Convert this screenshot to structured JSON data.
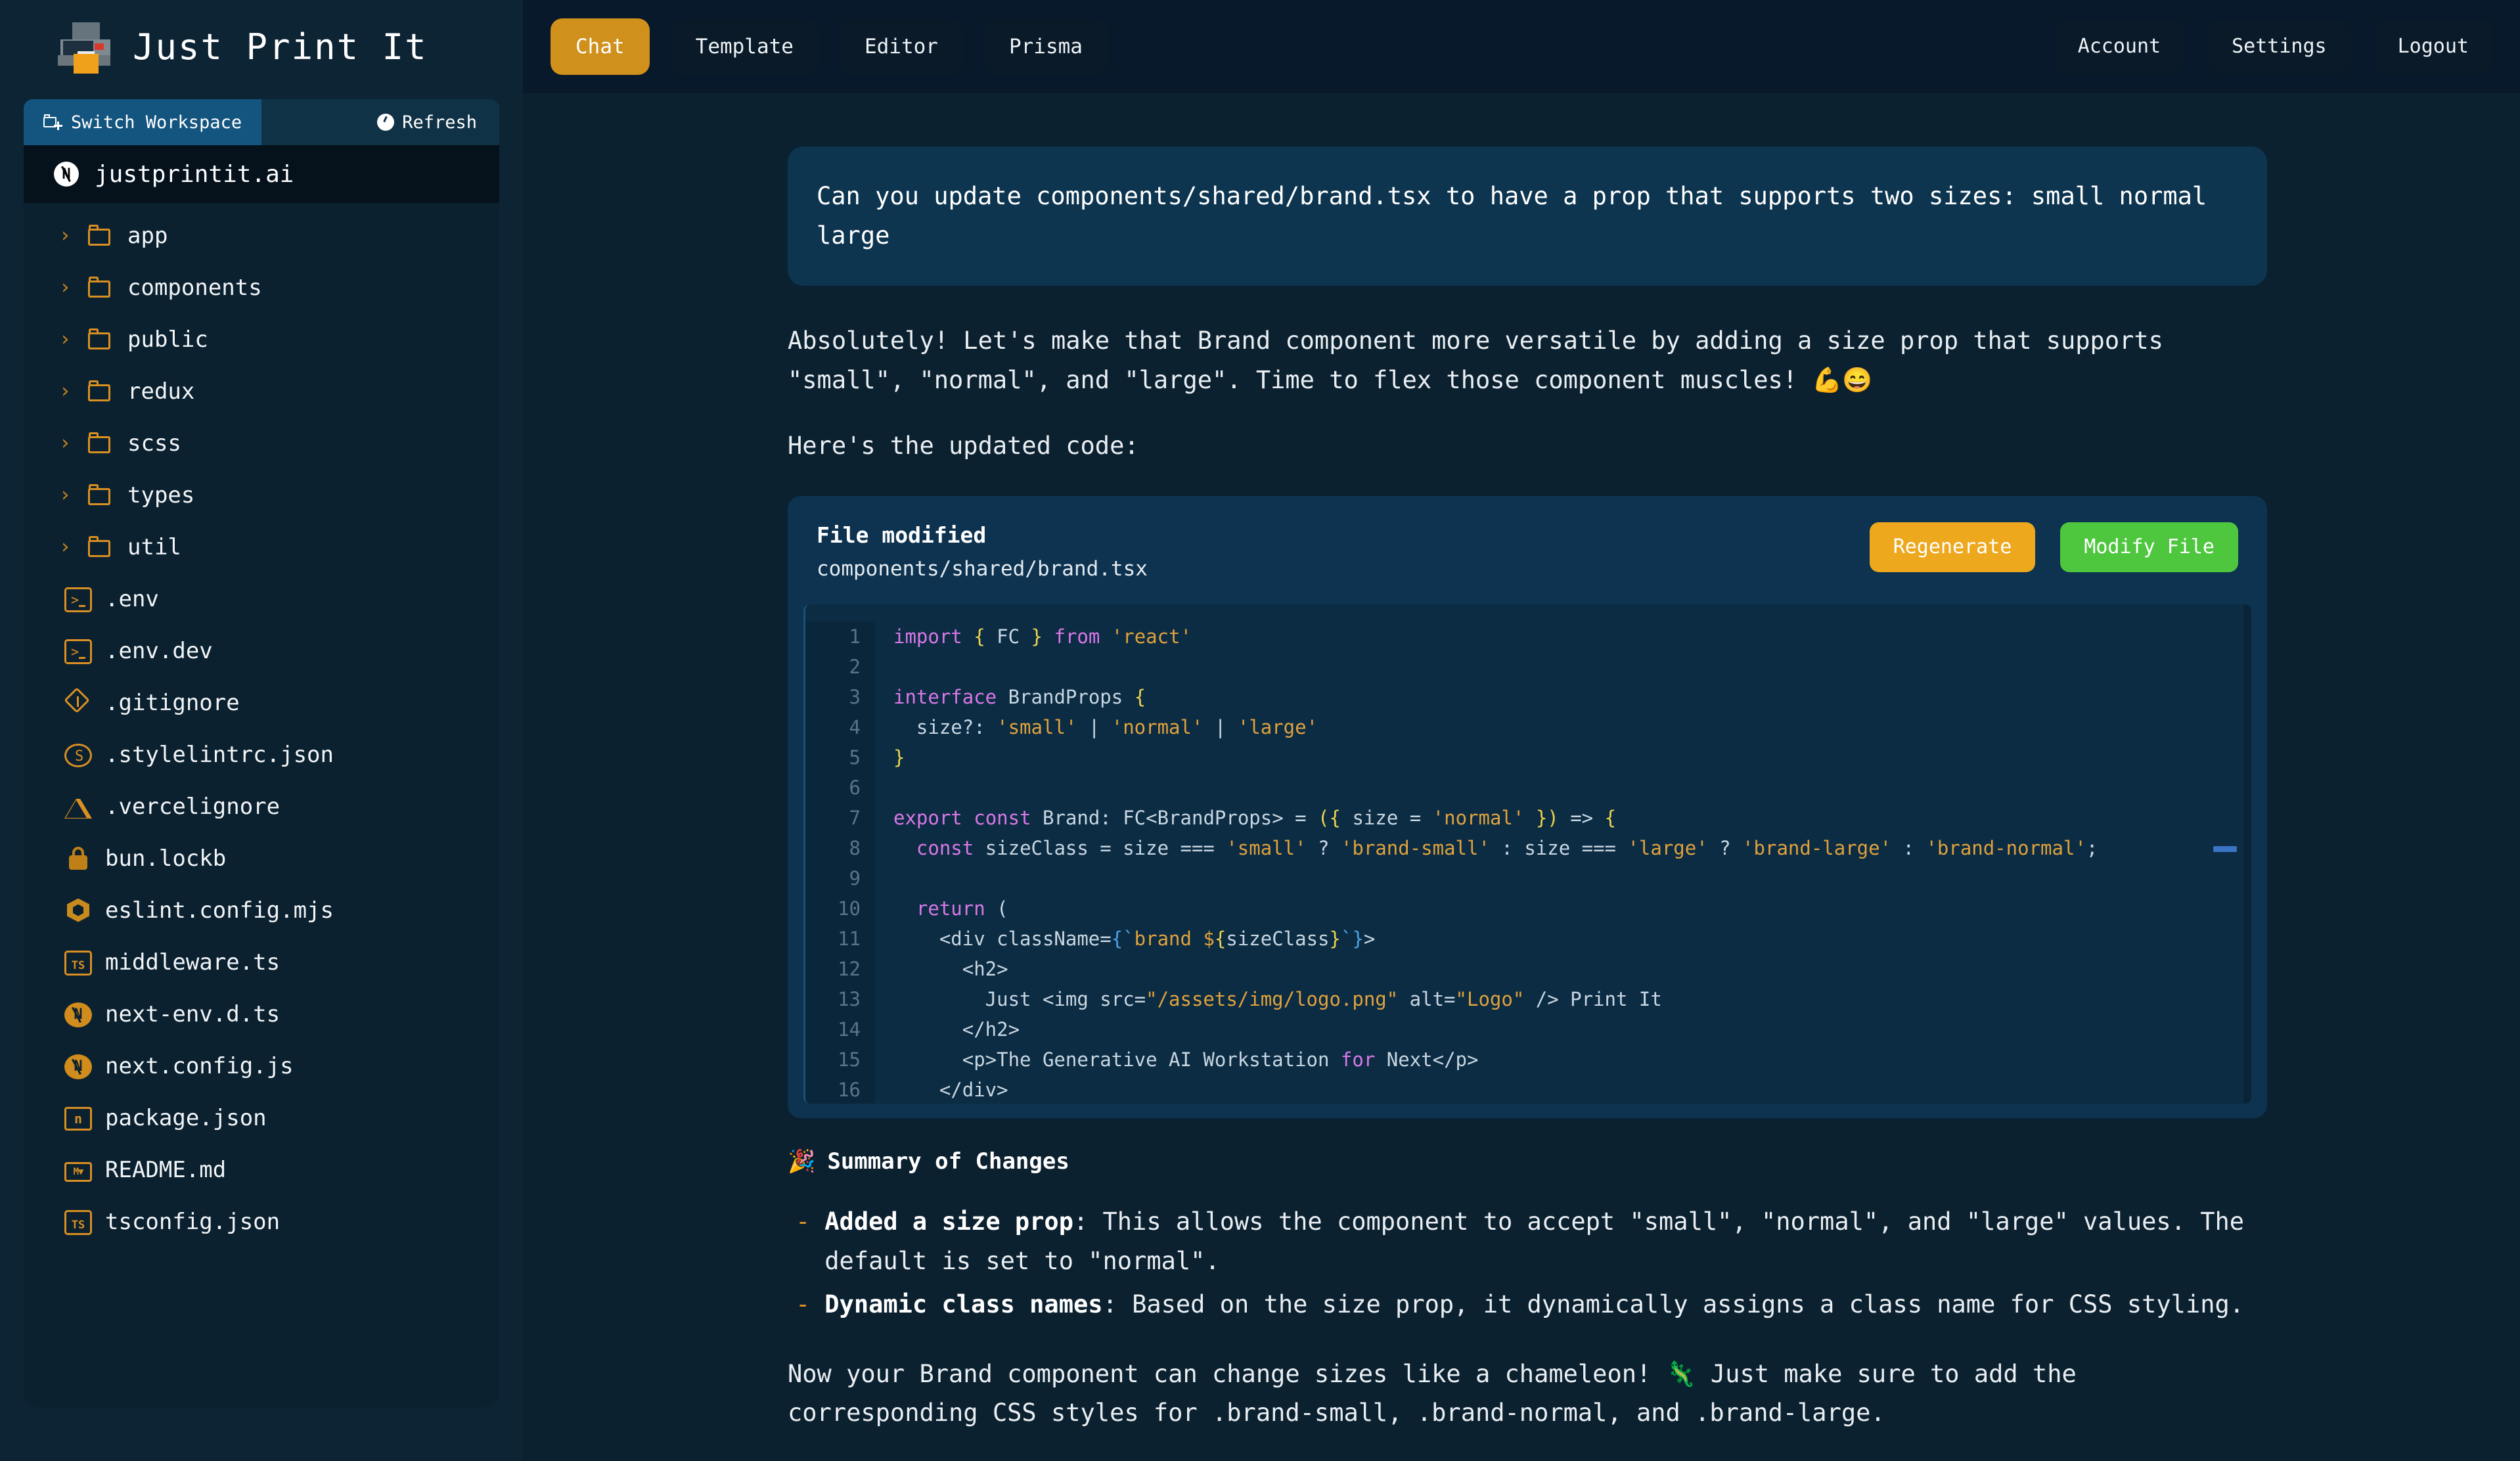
{
  "app": {
    "title": "Just Print It",
    "logo_icon": "printer-icon"
  },
  "sidebar": {
    "switch_workspace": {
      "label": "Switch Workspace",
      "icon": "folder-plus-icon"
    },
    "refresh": {
      "label": "Refresh",
      "icon": "refresh-icon"
    },
    "workspace_name": "justprintit.ai",
    "workspace_icon": "nextjs-icon",
    "folders": [
      {
        "label": "app",
        "icon": "folder-icon",
        "chevron": "›"
      },
      {
        "label": "components",
        "icon": "folder-icon",
        "chevron": "›"
      },
      {
        "label": "public",
        "icon": "folder-icon",
        "chevron": "›"
      },
      {
        "label": "redux",
        "icon": "folder-icon",
        "chevron": "›"
      },
      {
        "label": "scss",
        "icon": "folder-icon",
        "chevron": "›"
      },
      {
        "label": "types",
        "icon": "folder-icon",
        "chevron": "›"
      },
      {
        "label": "util",
        "icon": "folder-icon",
        "chevron": "›"
      }
    ],
    "files": [
      {
        "label": ".env",
        "icon": "terminal-icon"
      },
      {
        "label": ".env.dev",
        "icon": "terminal-icon"
      },
      {
        "label": ".gitignore",
        "icon": "git-icon"
      },
      {
        "label": ".stylelintrc.json",
        "icon": "stylelint-icon"
      },
      {
        "label": ".vercelignore",
        "icon": "vercel-triangle-icon"
      },
      {
        "label": "bun.lockb",
        "icon": "lock-icon"
      },
      {
        "label": "eslint.config.mjs",
        "icon": "eslint-hexagon-icon"
      },
      {
        "label": "middleware.ts",
        "icon": "typescript-icon"
      },
      {
        "label": "next-env.d.ts",
        "icon": "nextjs-icon"
      },
      {
        "label": "next.config.js",
        "icon": "nextjs-icon"
      },
      {
        "label": "package.json",
        "icon": "npm-icon"
      },
      {
        "label": "README.md",
        "icon": "markdown-icon"
      },
      {
        "label": "tsconfig.json",
        "icon": "typescript-icon"
      }
    ]
  },
  "topbar": {
    "tabs": [
      {
        "label": "Chat",
        "active": true
      },
      {
        "label": "Template",
        "active": false
      },
      {
        "label": "Editor",
        "active": false
      },
      {
        "label": "Prisma",
        "active": false
      }
    ],
    "actions": [
      {
        "label": "Account"
      },
      {
        "label": "Settings"
      },
      {
        "label": "Logout"
      }
    ]
  },
  "chat": {
    "user_message": "Can you update components/shared/brand.tsx to have a prop that supports two sizes: small normal large",
    "assistant_intro": "Absolutely! Let's make that Brand component more versatile by adding a size prop that supports \"small\", \"normal\", and \"large\". Time to flex those component muscles! 💪😄",
    "assistant_lead": "Here's the updated code:",
    "file_card": {
      "status": "File modified",
      "path": "components/shared/brand.tsx",
      "regenerate_label": "Regenerate",
      "modify_label": "Modify File"
    },
    "summary": {
      "emoji": "🎉",
      "heading": "Summary of Changes",
      "items": [
        {
          "marker": "-",
          "title": "Added a size prop",
          "text": ": This allows the component to accept \"small\", \"normal\", and \"large\" values. The default is set to \"normal\"."
        },
        {
          "marker": "-",
          "title": "Dynamic class names",
          "text": ": Based on the size prop, it dynamically assigns a class name for CSS styling."
        }
      ]
    },
    "closing": "Now your Brand component can change sizes like a chameleon! 🦎 Just make sure to add the corresponding CSS styles for .brand-small, .brand-normal, and .brand-large."
  },
  "code_block": {
    "language": "tsx",
    "lines": [
      {
        "n": "1",
        "tokens": [
          {
            "t": "import",
            "c": "k"
          },
          {
            "t": " ",
            "c": "pl"
          },
          {
            "t": "{",
            "c": "b"
          },
          {
            "t": " FC ",
            "c": "pl"
          },
          {
            "t": "}",
            "c": "b"
          },
          {
            "t": " ",
            "c": "pl"
          },
          {
            "t": "from",
            "c": "k"
          },
          {
            "t": " ",
            "c": "pl"
          },
          {
            "t": "'react'",
            "c": "s"
          }
        ]
      },
      {
        "n": "2",
        "tokens": []
      },
      {
        "n": "3",
        "tokens": [
          {
            "t": "interface",
            "c": "k"
          },
          {
            "t": " BrandProps ",
            "c": "pl"
          },
          {
            "t": "{",
            "c": "b"
          }
        ]
      },
      {
        "n": "4",
        "tokens": [
          {
            "t": "  size?: ",
            "c": "pl"
          },
          {
            "t": "'small'",
            "c": "s"
          },
          {
            "t": " | ",
            "c": "pl"
          },
          {
            "t": "'normal'",
            "c": "s"
          },
          {
            "t": " | ",
            "c": "pl"
          },
          {
            "t": "'large'",
            "c": "s"
          }
        ]
      },
      {
        "n": "5",
        "tokens": [
          {
            "t": "}",
            "c": "b"
          }
        ]
      },
      {
        "n": "6",
        "tokens": []
      },
      {
        "n": "7",
        "tokens": [
          {
            "t": "export",
            "c": "k"
          },
          {
            "t": " ",
            "c": "pl"
          },
          {
            "t": "const",
            "c": "k"
          },
          {
            "t": " Brand: FC<BrandProps> = ",
            "c": "pl"
          },
          {
            "t": "(",
            "c": "b"
          },
          {
            "t": "{",
            "c": "b"
          },
          {
            "t": " size = ",
            "c": "pl"
          },
          {
            "t": "'normal'",
            "c": "s"
          },
          {
            "t": " ",
            "c": "pl"
          },
          {
            "t": "}",
            "c": "b"
          },
          {
            "t": ")",
            "c": "b"
          },
          {
            "t": " => ",
            "c": "pl"
          },
          {
            "t": "{",
            "c": "b"
          }
        ]
      },
      {
        "n": "8",
        "tokens": [
          {
            "t": "  ",
            "c": "pl"
          },
          {
            "t": "const",
            "c": "k"
          },
          {
            "t": " sizeClass = size === ",
            "c": "pl"
          },
          {
            "t": "'small'",
            "c": "s"
          },
          {
            "t": " ? ",
            "c": "pl"
          },
          {
            "t": "'brand-small'",
            "c": "s"
          },
          {
            "t": " : size === ",
            "c": "pl"
          },
          {
            "t": "'large'",
            "c": "s"
          },
          {
            "t": " ? ",
            "c": "pl"
          },
          {
            "t": "'brand-large'",
            "c": "s"
          },
          {
            "t": " : ",
            "c": "pl"
          },
          {
            "t": "'brand-normal'",
            "c": "s"
          },
          {
            "t": ";",
            "c": "pl"
          }
        ]
      },
      {
        "n": "9",
        "tokens": []
      },
      {
        "n": "10",
        "tokens": [
          {
            "t": "  ",
            "c": "pl"
          },
          {
            "t": "return",
            "c": "k"
          },
          {
            "t": " (",
            "c": "pl"
          }
        ]
      },
      {
        "n": "11",
        "tokens": [
          {
            "t": "    <div className=",
            "c": "pl"
          },
          {
            "t": "{",
            "c": "tl"
          },
          {
            "t": "`",
            "c": "tl"
          },
          {
            "t": "brand ",
            "c": "s"
          },
          {
            "t": "$",
            "c": "s"
          },
          {
            "t": "{",
            "c": "b"
          },
          {
            "t": "sizeClass",
            "c": "pl"
          },
          {
            "t": "}",
            "c": "b"
          },
          {
            "t": "`",
            "c": "tl"
          },
          {
            "t": "}",
            "c": "tl"
          },
          {
            "t": ">",
            "c": "pl"
          }
        ]
      },
      {
        "n": "12",
        "tokens": [
          {
            "t": "      <h2>",
            "c": "pl"
          }
        ]
      },
      {
        "n": "13",
        "tokens": [
          {
            "t": "        Just <img src=",
            "c": "pl"
          },
          {
            "t": "\"/assets/img/logo.png\"",
            "c": "s"
          },
          {
            "t": " alt=",
            "c": "pl"
          },
          {
            "t": "\"Logo\"",
            "c": "s"
          },
          {
            "t": " /> Print It",
            "c": "pl"
          }
        ]
      },
      {
        "n": "14",
        "tokens": [
          {
            "t": "      </h2>",
            "c": "pl"
          }
        ]
      },
      {
        "n": "15",
        "tokens": [
          {
            "t": "      <p>The Generative AI Workstation ",
            "c": "pl"
          },
          {
            "t": "for",
            "c": "k"
          },
          {
            "t": " Next</p>",
            "c": "pl"
          }
        ]
      },
      {
        "n": "16",
        "tokens": [
          {
            "t": "    </div>",
            "c": "pl"
          }
        ]
      }
    ]
  },
  "colors": {
    "accent_orange": "#d0901c",
    "accent_green": "#4ec73f",
    "accent_amber": "#eda81e",
    "sidebar_bg": "#0d2434",
    "main_bg": "#0c2130",
    "user_bubble": "#0d3550",
    "code_bg": "#0c2c44",
    "scrollbar_thumb": "#3a74c4"
  }
}
